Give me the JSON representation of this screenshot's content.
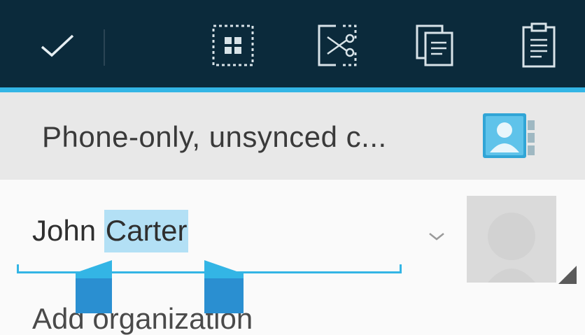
{
  "action_bar": {
    "done_icon": "checkmark-icon",
    "select_all_icon": "select-all-icon",
    "cut_icon": "cut-icon",
    "copy_icon": "copy-icon",
    "paste_icon": "paste-icon",
    "background": "#0b2a3b",
    "accent": "#33b5e5"
  },
  "account": {
    "label": "Phone-only, unsynced c...",
    "icon": "contact-card-icon"
  },
  "name_field": {
    "first_name": "John",
    "selected_text": "Carter",
    "expand_icon": "chevron-down-icon"
  },
  "photo": {
    "icon": "contact-photo-placeholder-icon"
  },
  "organization": {
    "placeholder": "Add organization"
  },
  "selection": {
    "left_handle": "selection-handle-left",
    "right_handle": "selection-handle-right",
    "highlight_color": "#b3e0f5"
  }
}
